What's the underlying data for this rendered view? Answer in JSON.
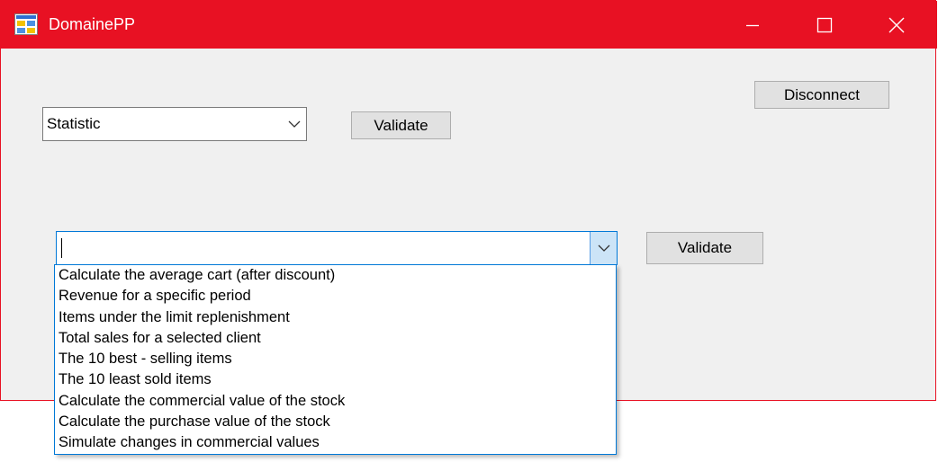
{
  "window": {
    "title": "DomainePP",
    "controls": {
      "minimize_icon": "minimize-icon",
      "maximize_icon": "maximize-icon",
      "close_icon": "close-icon"
    },
    "accent_color": "#e81123",
    "background_color": "#f0f0f0"
  },
  "toolbar": {
    "disconnect_label": "Disconnect"
  },
  "category": {
    "selected": "Statistic",
    "validate_label": "Validate"
  },
  "statistic": {
    "value": "",
    "validate_label": "Validate",
    "options": [
      "Calculate the average cart (after discount)",
      "Revenue for a specific period",
      "Items under the limit replenishment",
      "Total sales for a selected client",
      "The 10 best - selling items",
      "The 10 least sold items",
      "Calculate the commercial value of the stock",
      "Calculate the purchase value of the stock",
      "Simulate changes in commercial values"
    ],
    "focus_color": "#0078d7"
  }
}
